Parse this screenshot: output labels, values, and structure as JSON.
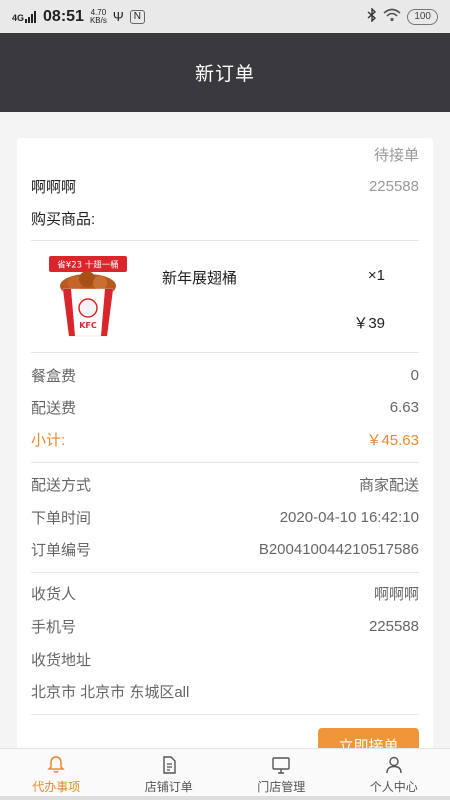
{
  "status_bar": {
    "network": "4G",
    "time": "08:51",
    "speed_value": "4.70",
    "speed_unit": "KB/s",
    "badge": "N",
    "battery": "100"
  },
  "header": {
    "title": "新订单"
  },
  "order": {
    "status": "待接单",
    "customer_name": "啊啊啊",
    "order_code": "225588",
    "goods_label": "购买商品:",
    "product": {
      "image_label": "省¥23 十翅一桶",
      "image_brand": "KFC",
      "name": "新年展翅桶",
      "quantity": "×1",
      "price": "￥39"
    },
    "fees": [
      {
        "label": "餐盒费",
        "value": "0"
      },
      {
        "label": "配送费",
        "value": "6.63"
      },
      {
        "label": "小计:",
        "value": "￥45.63"
      }
    ],
    "delivery": [
      {
        "label": "配送方式",
        "value": "商家配送"
      },
      {
        "label": "下单时间",
        "value": "2020-04-10 16:42:10"
      },
      {
        "label": "订单编号",
        "value": "B200410044210517586"
      }
    ],
    "receiver": [
      {
        "label": "收货人",
        "value": "啊啊啊"
      },
      {
        "label": "手机号",
        "value": "225588"
      }
    ],
    "address_label": "收货地址",
    "address_value": "北京市 北京市 东城区all",
    "accept_button": "立即接单"
  },
  "tabs": [
    {
      "label": "代办事项",
      "icon": "bell-icon",
      "active": true
    },
    {
      "label": "店铺订单",
      "icon": "document-icon",
      "active": false
    },
    {
      "label": "门店管理",
      "icon": "monitor-icon",
      "active": false
    },
    {
      "label": "个人中心",
      "icon": "person-icon",
      "active": false
    }
  ],
  "colors": {
    "accent": "#e8892a",
    "button": "#f0963a",
    "header_bg": "#3a3a3e"
  }
}
